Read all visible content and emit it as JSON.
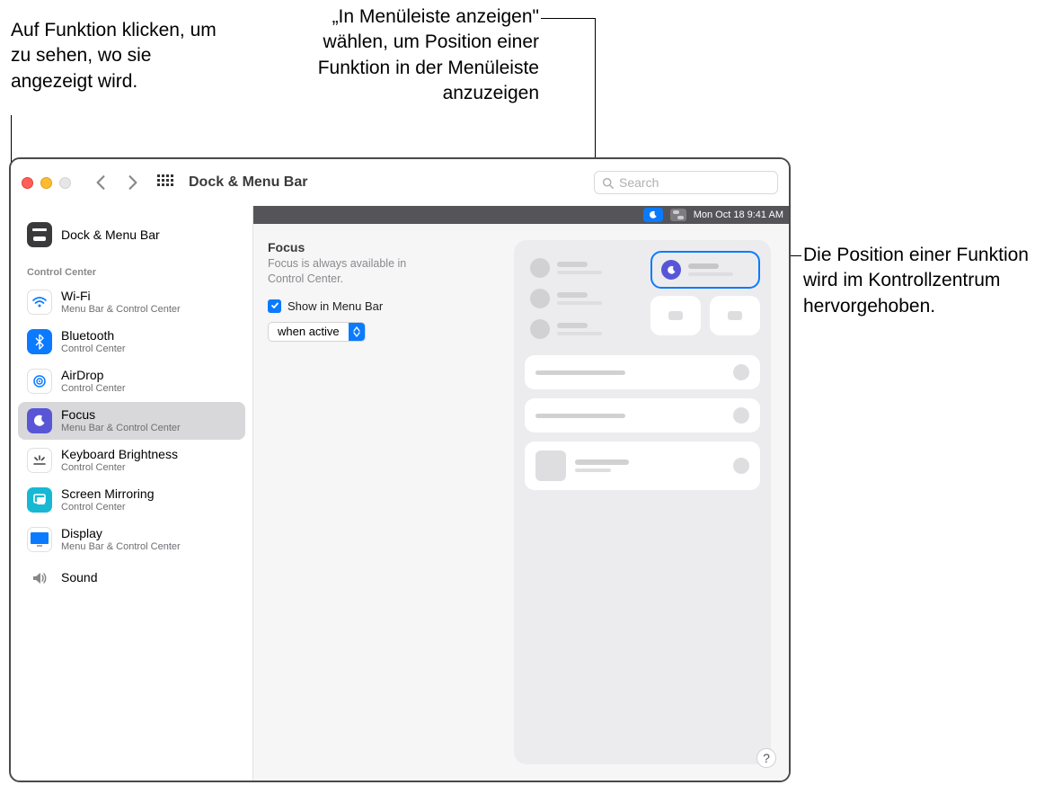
{
  "callouts": {
    "left": "Auf Funktion klicken, um zu sehen, wo sie angezeigt wird.",
    "top_right": "„In Menüleiste anzeigen\" wählen, um Position einer Funktion in der Menüleiste anzuzeigen",
    "right": "Die Position einer Funktion wird im Kontrollzentrum hervorgehoben."
  },
  "toolbar": {
    "title": "Dock & Menu Bar",
    "search_placeholder": "Search"
  },
  "sidebar": {
    "section_top": {
      "label": "Dock & Menu Bar",
      "sub": ""
    },
    "section_label": "Control Center",
    "items": [
      {
        "label": "Wi-Fi",
        "sub": "Menu Bar & Control Center"
      },
      {
        "label": "Bluetooth",
        "sub": "Control Center"
      },
      {
        "label": "AirDrop",
        "sub": "Control Center"
      },
      {
        "label": "Focus",
        "sub": "Menu Bar & Control Center"
      },
      {
        "label": "Keyboard Brightness",
        "sub": "Control Center"
      },
      {
        "label": "Screen Mirroring",
        "sub": "Control Center"
      },
      {
        "label": "Display",
        "sub": "Menu Bar & Control Center"
      },
      {
        "label": "Sound",
        "sub": ""
      }
    ]
  },
  "menubar_preview": {
    "datetime": "Mon Oct 18  9:41 AM"
  },
  "detail": {
    "title": "Focus",
    "desc_line1": "Focus is always available in",
    "desc_line2": "Control Center.",
    "checkbox_label": "Show in Menu Bar",
    "select_value": "when active"
  },
  "help": "?"
}
